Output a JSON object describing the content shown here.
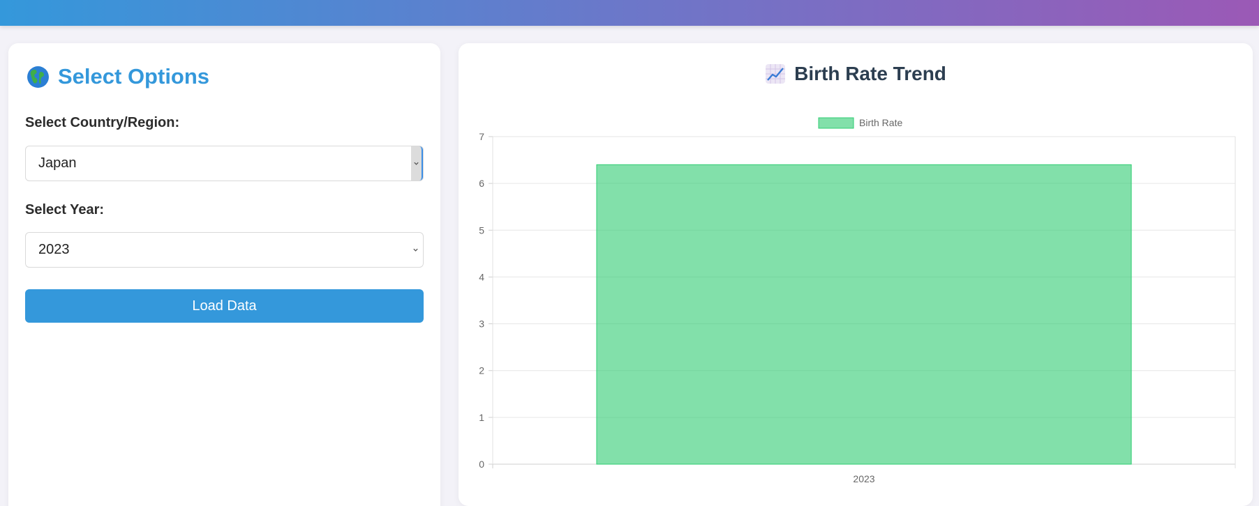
{
  "header": {},
  "options_panel": {
    "title": "Select Options",
    "title_icon": "globe-icon",
    "country_label": "Select Country/Region:",
    "country_value": "Japan",
    "year_label": "Select Year:",
    "year_value": "2023",
    "load_button_label": "Load Data"
  },
  "chart_panel": {
    "title": "Birth Rate Trend",
    "title_icon": "chart-increasing-icon"
  },
  "colors": {
    "accent": "#3498db",
    "gradient_start": "#3498db",
    "gradient_end": "#9b59b6",
    "bar_fill": "rgba(46,204,113,0.6)",
    "bar_border": "#2ecc71"
  },
  "chart_data": {
    "type": "bar",
    "title": "Birth Rate Trend",
    "categories": [
      "2023"
    ],
    "series": [
      {
        "name": "Birth Rate",
        "values": [
          6.4
        ]
      }
    ],
    "ylim": [
      0,
      7
    ],
    "yticks": [
      0,
      1,
      2,
      3,
      4,
      5,
      6,
      7
    ],
    "xlabel": "",
    "ylabel": "",
    "grid": true,
    "legend": "top-center"
  }
}
